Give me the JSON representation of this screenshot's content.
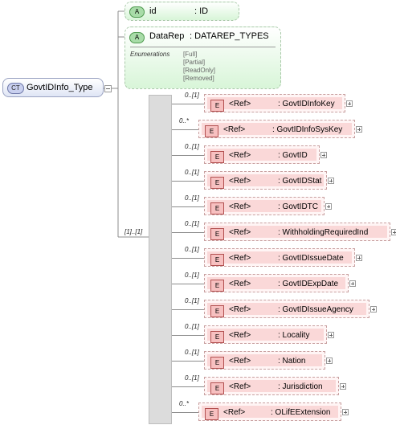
{
  "complex_type": {
    "badge": "CT",
    "name": "GovtIDInfo_Type"
  },
  "attributes": [
    {
      "badge": "A",
      "name": "id",
      "type": ": ID"
    },
    {
      "badge": "A",
      "name": "DataRep",
      "type": ": DATAREP_TYPES",
      "enumerations_label": "Enumerations",
      "enumerations": [
        "[Full]",
        "[Partial]",
        "[ReadOnly]",
        "[Removed]"
      ]
    }
  ],
  "sequence": {
    "occurrence": "[1]..[1]"
  },
  "elements": [
    {
      "occurrence": "0..[1]",
      "badge": "E",
      "ref": "<Ref>",
      "name": ": GovtIDInfoKey"
    },
    {
      "occurrence": "0..*",
      "badge": "E",
      "ref": "<Ref>",
      "name": ": GovtIDInfoSysKey"
    },
    {
      "occurrence": "0..[1]",
      "badge": "E",
      "ref": "<Ref>",
      "name": ": GovtID"
    },
    {
      "occurrence": "0..[1]",
      "badge": "E",
      "ref": "<Ref>",
      "name": ": GovtIDStat"
    },
    {
      "occurrence": "0..[1]",
      "badge": "E",
      "ref": "<Ref>",
      "name": ": GovtIDTC"
    },
    {
      "occurrence": "0..[1]",
      "badge": "E",
      "ref": "<Ref>",
      "name": ": WithholdingRequiredInd"
    },
    {
      "occurrence": "0..[1]",
      "badge": "E",
      "ref": "<Ref>",
      "name": ": GovtIDIssueDate"
    },
    {
      "occurrence": "0..[1]",
      "badge": "E",
      "ref": "<Ref>",
      "name": ": GovtIDExpDate"
    },
    {
      "occurrence": "0..[1]",
      "badge": "E",
      "ref": "<Ref>",
      "name": ": GovtIDIssueAgency"
    },
    {
      "occurrence": "0..[1]",
      "badge": "E",
      "ref": "<Ref>",
      "name": ": Locality"
    },
    {
      "occurrence": "0..[1]",
      "badge": "E",
      "ref": "<Ref>",
      "name": ": Nation"
    },
    {
      "occurrence": "0..[1]",
      "badge": "E",
      "ref": "<Ref>",
      "name": ": Jurisdiction"
    },
    {
      "occurrence": "0..*",
      "badge": "E",
      "ref": "<Ref>",
      "name": ": OLifEExtension"
    }
  ]
}
